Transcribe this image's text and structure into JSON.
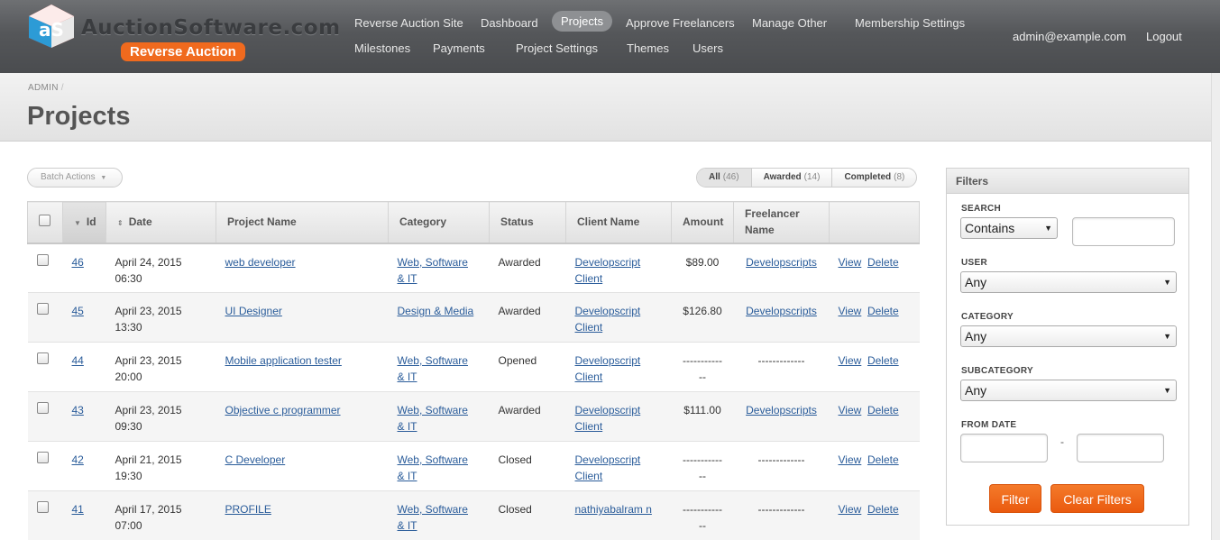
{
  "brand": {
    "name": "AuctionSoftware.com",
    "badge": "Reverse Auction",
    "mark": "aS"
  },
  "nav": {
    "row1": [
      "Reverse Auction Site",
      "Dashboard",
      "Projects",
      "Approve Freelancers",
      "Manage Other",
      "Membership Settings"
    ],
    "row2": [
      "Milestones",
      "Payments",
      "Project Settings",
      "Themes",
      "Users"
    ],
    "active": "Projects",
    "user_email": "admin@example.com",
    "logout": "Logout"
  },
  "breadcrumb": {
    "root": "ADMIN",
    "sep": "/"
  },
  "page_title": "Projects",
  "batch_actions": "Batch Actions",
  "tabs": [
    {
      "label": "All",
      "count": "(46)"
    },
    {
      "label": "Awarded",
      "count": "(14)"
    },
    {
      "label": "Completed",
      "count": "(8)"
    }
  ],
  "table": {
    "headers": {
      "id": "Id",
      "date": "Date",
      "project_name": "Project Name",
      "category": "Category",
      "status": "Status",
      "client": "Client Name",
      "amount": "Amount",
      "freelancer_line1": "Freelancer",
      "freelancer_line2": "Name"
    },
    "action_view": "View",
    "action_delete": "Delete",
    "rows": [
      {
        "id": "46",
        "date": "April 24, 2015",
        "time": "06:30",
        "name": "web developer",
        "cat1": "Web, Software",
        "cat2": "& IT",
        "status": "Awarded",
        "client1": "Developscript",
        "client2": "Client",
        "amount1": "$89.00",
        "amount2": "",
        "freelancer": "Developscripts",
        "freelancer_link": true
      },
      {
        "id": "45",
        "date": "April 23, 2015",
        "time": "13:30",
        "name": "UI Designer",
        "cat1": "Design & Media",
        "cat2": "",
        "status": "Awarded",
        "client1": "Developscript",
        "client2": "Client",
        "amount1": "$126.80",
        "amount2": "",
        "freelancer": "Developscripts",
        "freelancer_link": true
      },
      {
        "id": "44",
        "date": "April 23, 2015",
        "time": "20:00",
        "name": "Mobile application tester",
        "cat1": "Web, Software",
        "cat2": "& IT",
        "status": "Opened",
        "client1": "Developscript",
        "client2": "Client",
        "amount1": "-----------",
        "amount2": "--",
        "freelancer": "-------------",
        "freelancer_link": false
      },
      {
        "id": "43",
        "date": "April 23, 2015",
        "time": "09:30",
        "name": "Objective c programmer",
        "cat1": "Web, Software",
        "cat2": "& IT",
        "status": "Awarded",
        "client1": "Developscript",
        "client2": "Client",
        "amount1": "$111.00",
        "amount2": "",
        "freelancer": "Developscripts",
        "freelancer_link": true
      },
      {
        "id": "42",
        "date": "April 21, 2015",
        "time": "19:30",
        "name": "C Developer",
        "cat1": "Web, Software",
        "cat2": "& IT",
        "status": "Closed",
        "client1": "Developscript",
        "client2": "Client",
        "amount1": "-----------",
        "amount2": "--",
        "freelancer": "-------------",
        "freelancer_link": false
      },
      {
        "id": "41",
        "date": "April 17, 2015",
        "time": "07:00",
        "name": "PROFILE",
        "cat1": "Web, Software",
        "cat2": "& IT",
        "status": "Closed",
        "client1": "nathiyabalram n",
        "client2": "",
        "amount1": "-----------",
        "amount2": "--",
        "freelancer": "-------------",
        "freelancer_link": false
      }
    ]
  },
  "filters": {
    "title": "Filters",
    "search_label": "SEARCH",
    "search_mode": "Contains",
    "user_label": "USER",
    "user_value": "Any",
    "category_label": "CATEGORY",
    "category_value": "Any",
    "subcategory_label": "SUBCATEGORY",
    "subcategory_value": "Any",
    "from_date_label": "FROM DATE",
    "date_sep": "-",
    "filter_button": "Filter",
    "clear_button": "Clear Filters"
  },
  "colors": {
    "accent": "#f06a1e",
    "link": "#2a5c9a",
    "header_bg": "#55575a"
  }
}
